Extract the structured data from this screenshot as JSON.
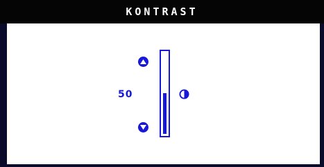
{
  "title": "KONTRAST",
  "contrast": {
    "value": "50",
    "level": 0.5,
    "up_icon": "arrow-up-icon",
    "down_icon": "arrow-down-icon",
    "contrast_icon": "contrast-icon"
  },
  "colors": {
    "accent": "#1818d8",
    "titlebar": "#050505",
    "frame": "#0a0a2a",
    "background": "#ffffff"
  }
}
